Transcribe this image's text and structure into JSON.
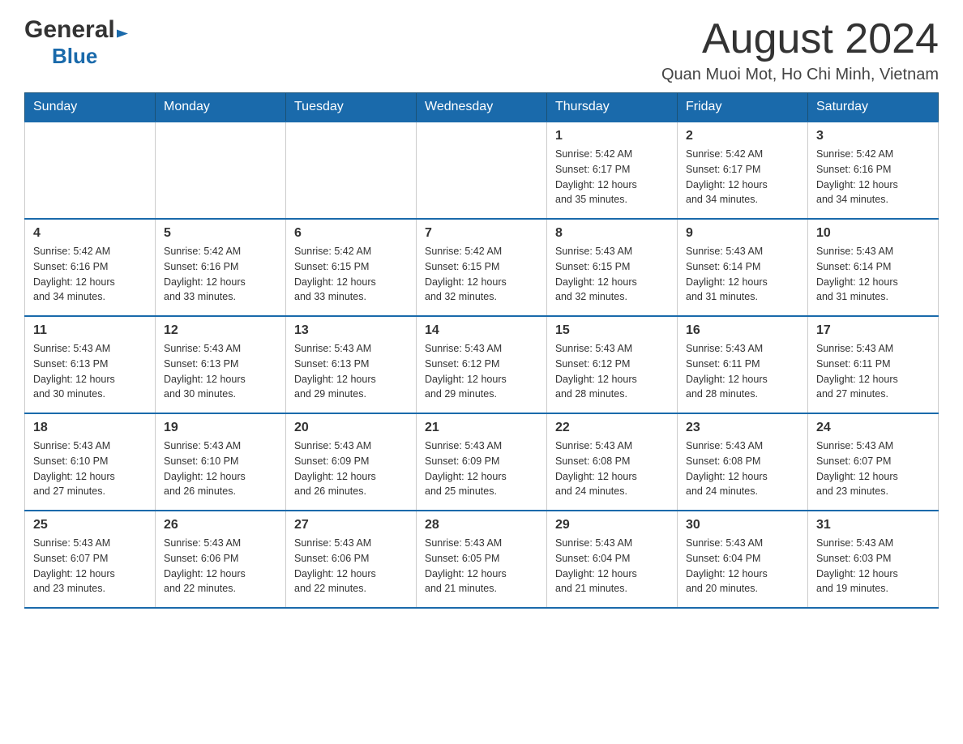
{
  "header": {
    "logo_general": "General",
    "logo_blue": "Blue",
    "month_year": "August 2024",
    "location": "Quan Muoi Mot, Ho Chi Minh, Vietnam"
  },
  "days_of_week": [
    "Sunday",
    "Monday",
    "Tuesday",
    "Wednesday",
    "Thursday",
    "Friday",
    "Saturday"
  ],
  "weeks": [
    [
      {
        "day": "",
        "info": ""
      },
      {
        "day": "",
        "info": ""
      },
      {
        "day": "",
        "info": ""
      },
      {
        "day": "",
        "info": ""
      },
      {
        "day": "1",
        "info": "Sunrise: 5:42 AM\nSunset: 6:17 PM\nDaylight: 12 hours\nand 35 minutes."
      },
      {
        "day": "2",
        "info": "Sunrise: 5:42 AM\nSunset: 6:17 PM\nDaylight: 12 hours\nand 34 minutes."
      },
      {
        "day": "3",
        "info": "Sunrise: 5:42 AM\nSunset: 6:16 PM\nDaylight: 12 hours\nand 34 minutes."
      }
    ],
    [
      {
        "day": "4",
        "info": "Sunrise: 5:42 AM\nSunset: 6:16 PM\nDaylight: 12 hours\nand 34 minutes."
      },
      {
        "day": "5",
        "info": "Sunrise: 5:42 AM\nSunset: 6:16 PM\nDaylight: 12 hours\nand 33 minutes."
      },
      {
        "day": "6",
        "info": "Sunrise: 5:42 AM\nSunset: 6:15 PM\nDaylight: 12 hours\nand 33 minutes."
      },
      {
        "day": "7",
        "info": "Sunrise: 5:42 AM\nSunset: 6:15 PM\nDaylight: 12 hours\nand 32 minutes."
      },
      {
        "day": "8",
        "info": "Sunrise: 5:43 AM\nSunset: 6:15 PM\nDaylight: 12 hours\nand 32 minutes."
      },
      {
        "day": "9",
        "info": "Sunrise: 5:43 AM\nSunset: 6:14 PM\nDaylight: 12 hours\nand 31 minutes."
      },
      {
        "day": "10",
        "info": "Sunrise: 5:43 AM\nSunset: 6:14 PM\nDaylight: 12 hours\nand 31 minutes."
      }
    ],
    [
      {
        "day": "11",
        "info": "Sunrise: 5:43 AM\nSunset: 6:13 PM\nDaylight: 12 hours\nand 30 minutes."
      },
      {
        "day": "12",
        "info": "Sunrise: 5:43 AM\nSunset: 6:13 PM\nDaylight: 12 hours\nand 30 minutes."
      },
      {
        "day": "13",
        "info": "Sunrise: 5:43 AM\nSunset: 6:13 PM\nDaylight: 12 hours\nand 29 minutes."
      },
      {
        "day": "14",
        "info": "Sunrise: 5:43 AM\nSunset: 6:12 PM\nDaylight: 12 hours\nand 29 minutes."
      },
      {
        "day": "15",
        "info": "Sunrise: 5:43 AM\nSunset: 6:12 PM\nDaylight: 12 hours\nand 28 minutes."
      },
      {
        "day": "16",
        "info": "Sunrise: 5:43 AM\nSunset: 6:11 PM\nDaylight: 12 hours\nand 28 minutes."
      },
      {
        "day": "17",
        "info": "Sunrise: 5:43 AM\nSunset: 6:11 PM\nDaylight: 12 hours\nand 27 minutes."
      }
    ],
    [
      {
        "day": "18",
        "info": "Sunrise: 5:43 AM\nSunset: 6:10 PM\nDaylight: 12 hours\nand 27 minutes."
      },
      {
        "day": "19",
        "info": "Sunrise: 5:43 AM\nSunset: 6:10 PM\nDaylight: 12 hours\nand 26 minutes."
      },
      {
        "day": "20",
        "info": "Sunrise: 5:43 AM\nSunset: 6:09 PM\nDaylight: 12 hours\nand 26 minutes."
      },
      {
        "day": "21",
        "info": "Sunrise: 5:43 AM\nSunset: 6:09 PM\nDaylight: 12 hours\nand 25 minutes."
      },
      {
        "day": "22",
        "info": "Sunrise: 5:43 AM\nSunset: 6:08 PM\nDaylight: 12 hours\nand 24 minutes."
      },
      {
        "day": "23",
        "info": "Sunrise: 5:43 AM\nSunset: 6:08 PM\nDaylight: 12 hours\nand 24 minutes."
      },
      {
        "day": "24",
        "info": "Sunrise: 5:43 AM\nSunset: 6:07 PM\nDaylight: 12 hours\nand 23 minutes."
      }
    ],
    [
      {
        "day": "25",
        "info": "Sunrise: 5:43 AM\nSunset: 6:07 PM\nDaylight: 12 hours\nand 23 minutes."
      },
      {
        "day": "26",
        "info": "Sunrise: 5:43 AM\nSunset: 6:06 PM\nDaylight: 12 hours\nand 22 minutes."
      },
      {
        "day": "27",
        "info": "Sunrise: 5:43 AM\nSunset: 6:06 PM\nDaylight: 12 hours\nand 22 minutes."
      },
      {
        "day": "28",
        "info": "Sunrise: 5:43 AM\nSunset: 6:05 PM\nDaylight: 12 hours\nand 21 minutes."
      },
      {
        "day": "29",
        "info": "Sunrise: 5:43 AM\nSunset: 6:04 PM\nDaylight: 12 hours\nand 21 minutes."
      },
      {
        "day": "30",
        "info": "Sunrise: 5:43 AM\nSunset: 6:04 PM\nDaylight: 12 hours\nand 20 minutes."
      },
      {
        "day": "31",
        "info": "Sunrise: 5:43 AM\nSunset: 6:03 PM\nDaylight: 12 hours\nand 19 minutes."
      }
    ]
  ]
}
